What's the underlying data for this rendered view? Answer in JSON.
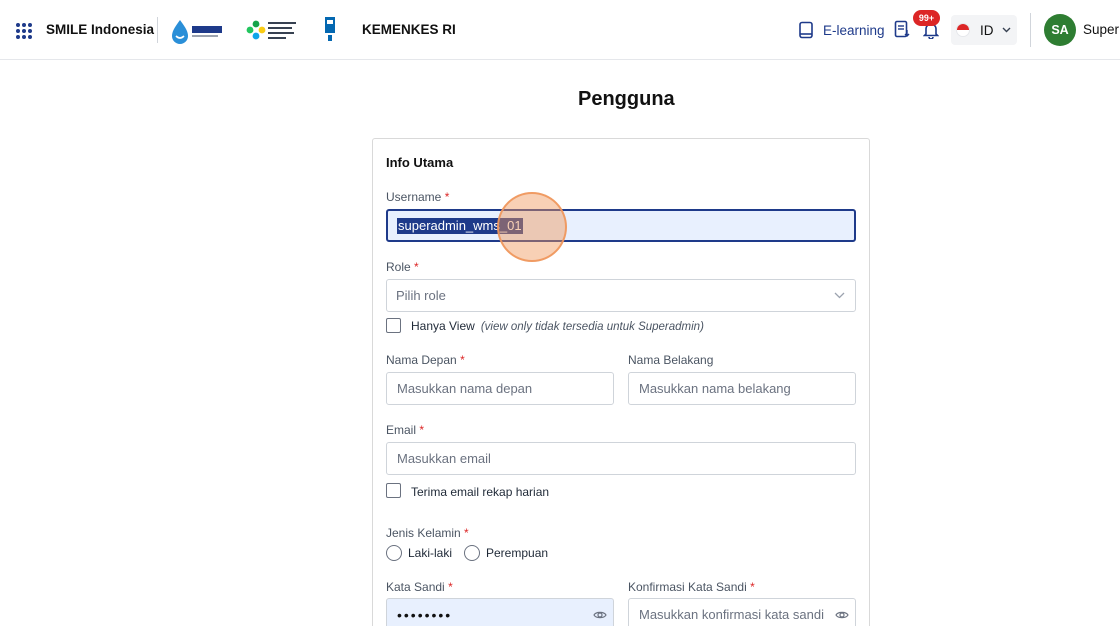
{
  "header": {
    "brand": "SMILE Indonesia",
    "org_text": "KEMENKES RI",
    "elearning_label": "E-learning",
    "notification_count": "99+",
    "language_code": "ID",
    "avatar_initials": "SA",
    "user_name": "Super Admin"
  },
  "page": {
    "title": "Pengguna"
  },
  "form": {
    "section_title": "Info Utama",
    "username": {
      "label": "Username",
      "required": "*",
      "value": "superadmin_wms_01"
    },
    "role": {
      "label": "Role",
      "required": "*",
      "placeholder": "Pilih role"
    },
    "view_only": {
      "label": "Hanya View",
      "note": "(view only tidak tersedia untuk Superadmin)"
    },
    "first_name": {
      "label": "Nama Depan",
      "required": "*",
      "placeholder": "Masukkan nama depan"
    },
    "last_name": {
      "label": "Nama Belakang",
      "placeholder": "Masukkan nama belakang"
    },
    "email": {
      "label": "Email",
      "required": "*",
      "placeholder": "Masukkan email"
    },
    "daily_recap": {
      "label": "Terima email rekap harian"
    },
    "gender": {
      "label": "Jenis Kelamin",
      "required": "*",
      "option_male": "Laki-laki",
      "option_female": "Perempuan"
    },
    "password": {
      "label": "Kata Sandi",
      "required": "*",
      "value": "••••••••"
    },
    "confirm_password": {
      "label": "Konfirmasi Kata Sandi",
      "required": "*",
      "placeholder": "Masukkan konfirmasi kata sandi"
    }
  },
  "colors": {
    "primary": "#1e3a8a",
    "danger": "#dc2626",
    "avatar_bg": "#2e7d32",
    "input_autofill": "#e8f0fe"
  }
}
